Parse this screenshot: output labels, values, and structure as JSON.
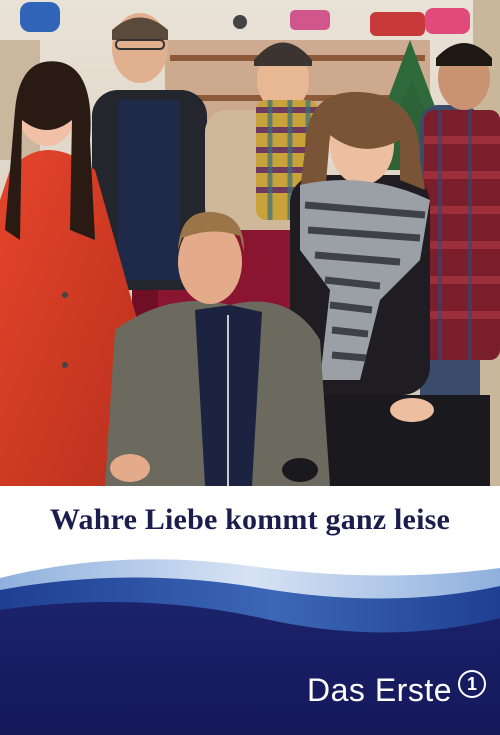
{
  "poster": {
    "title": "Wahre Liebe kommt ganz leise",
    "brand": "Das Erste",
    "brand_logo_glyph": "1"
  },
  "colors": {
    "title": "#1c1d4f",
    "footer_dark": "#14175a",
    "footer_wave": "#2b4fa0",
    "red_coat": "#d83a24",
    "armchair": "#8a1530",
    "jacket_grey": "#6c6a5e",
    "scarf_grey": "#9aa0a6"
  },
  "icons": {
    "channel_logo": "das-erste-one-circle-icon"
  }
}
